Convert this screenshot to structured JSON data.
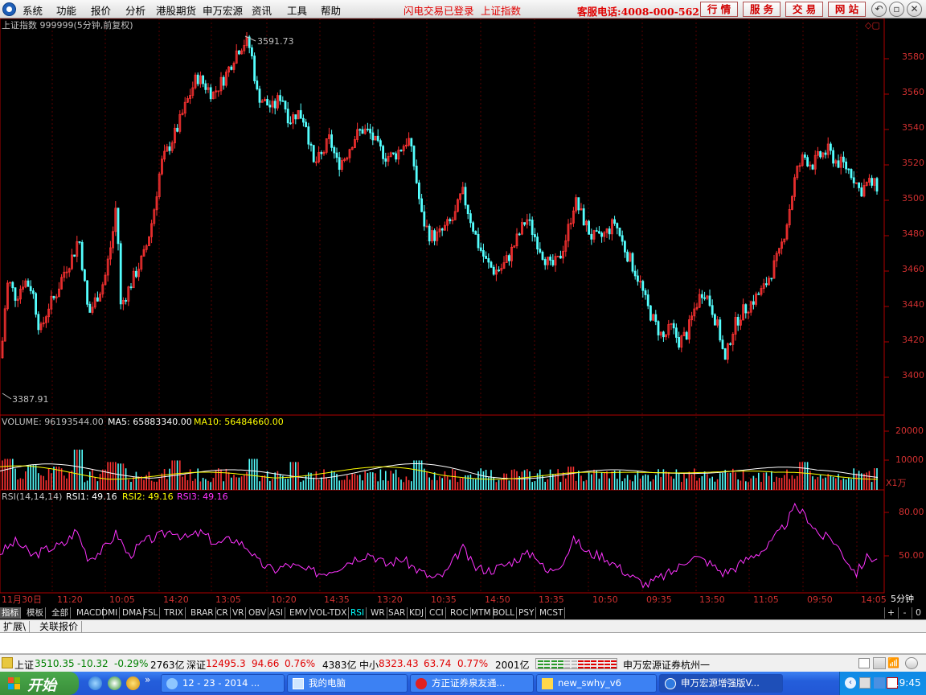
{
  "menubar": {
    "items": [
      "系统",
      "功能",
      "报价",
      "分析",
      "港股期货",
      "申万宏源",
      "资讯",
      "工具",
      "帮助"
    ],
    "red_links": [
      "闪电交易已登录",
      "上证指数"
    ],
    "hotline": "客服电话:4008-000-562",
    "buttons": [
      "行 情",
      "服 务",
      "交 易",
      "网 站"
    ],
    "window_controls": [
      "back-icon",
      "restore-icon",
      "close-icon"
    ]
  },
  "chart": {
    "title": "上证指数 999999(5分钟,前复权)",
    "high_label": "3591.73",
    "low_label": "3387.91",
    "price_ticks": [
      "3580",
      "3560",
      "3540",
      "3520",
      "3500",
      "3480",
      "3460",
      "3440",
      "3420",
      "3400"
    ],
    "volume_header": {
      "label": "VOLUME: 96193544.00",
      "ma5": "MA5: 65883340.00",
      "ma10": "MA10: 56484660.00"
    },
    "volume_ticks": [
      "20000",
      "10000"
    ],
    "volume_unit": "X1万",
    "rsi_header": {
      "label": "RSI(14,14,14)",
      "rsi1": "RSI1: 49.16",
      "rsi2": "RSI2: 49.16",
      "rsi3": "RSI3: 49.16"
    },
    "rsi_ticks": [
      "80.00",
      "50.00"
    ],
    "period_label": "5分钟",
    "time_labels": [
      "11月30日",
      "11:20",
      "10:05",
      "14:20",
      "13:05",
      "10:20",
      "14:35",
      "13:20",
      "10:35",
      "14:50",
      "13:35",
      "10:50",
      "09:35",
      "13:50",
      "11:05",
      "09:50",
      "14:05"
    ],
    "colors": {
      "up": "#ff3232",
      "down": "#54ffff",
      "ma5": "#ffffff",
      "ma10": "#ffff00",
      "rsi": "#ff33ff",
      "axis": "#b00000",
      "header_text": "#c0c0c0"
    }
  },
  "chart_data": [
    {
      "type": "line",
      "title": "上证指数 999999(5分钟,前复权)",
      "y_ticks": [
        3400,
        3420,
        3440,
        3460,
        3480,
        3500,
        3520,
        3540,
        3560,
        3580
      ],
      "high": 3591.73,
      "low": 3387.91,
      "x_tick_labels": [
        "11月30日",
        "11:20",
        "10:05",
        "14:20",
        "13:05",
        "10:20",
        "14:35",
        "13:20",
        "10:35",
        "14:50",
        "13:35",
        "10:50",
        "09:35",
        "13:50",
        "11:05",
        "09:50",
        "14:05"
      ]
    },
    {
      "type": "bar",
      "title": "VOLUME",
      "value": 96193544.0,
      "ma5": 65883340.0,
      "ma10": 56484660.0,
      "unit": "X1万",
      "y_ticks": [
        10000,
        20000
      ]
    },
    {
      "type": "line",
      "title": "RSI(14,14,14)",
      "rsi1": 49.16,
      "rsi2": 49.16,
      "rsi3": 49.16,
      "y_ticks": [
        50,
        80
      ]
    }
  ],
  "indicator_tabs": [
    "指标",
    "模板",
    "全部",
    "MACD",
    "DMI",
    "DMA",
    "FSL",
    "TRIX",
    "BRAR",
    "CR",
    "VR",
    "OBV",
    "ASI",
    "EMV",
    "VOL-TDX",
    "RSI",
    "WR",
    "SAR",
    "KDJ",
    "CCI",
    "ROC",
    "MTM",
    "BOLL",
    "PSY",
    "MCST"
  ],
  "indicator_controls": [
    "+",
    "-",
    "0"
  ],
  "bottom_tabs": [
    "扩展\\",
    "关联报价"
  ],
  "statusbar": {
    "sh_label": "上证",
    "sh_value": "3510.35",
    "sh_change": "-10.32",
    "sh_pct": "-0.29%",
    "sh_amount": "2763亿",
    "sz_label": "深证",
    "sz_value": "12495.3",
    "sz_change": "94.66",
    "sz_pct": "0.76%",
    "sz_amount": "4383亿",
    "zx_label": "中小",
    "zx_value": "8323.43",
    "zx_change": "63.74",
    "zx_pct": "0.77%",
    "zx_amount": "2001亿",
    "broker": "申万宏源证券杭州一"
  },
  "taskbar": {
    "start": "开始",
    "tasks": [
      "12 - 23 - 2014 ...",
      "我的电脑",
      "方正证券泉友通...",
      "new_swhy_v6",
      "申万宏源增强版V..."
    ],
    "clock": "19:45"
  }
}
